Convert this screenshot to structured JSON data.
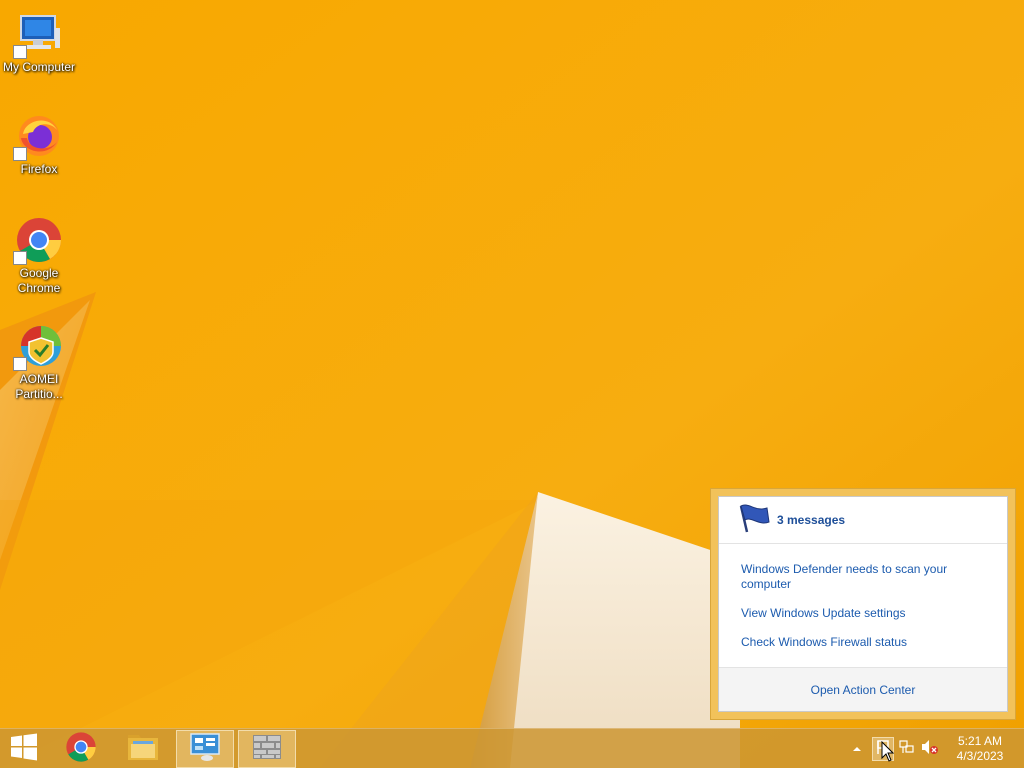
{
  "desktop": {
    "icons": [
      {
        "label": "My Computer",
        "icon": "computer-icon"
      },
      {
        "label": "Firefox",
        "icon": "firefox-icon"
      },
      {
        "label": "Google Chrome",
        "icon": "chrome-icon"
      },
      {
        "label": "AOMEI Partitio...",
        "icon": "aomei-partition-icon"
      }
    ]
  },
  "action_center": {
    "header": "3 messages",
    "messages": [
      "Windows Defender needs to scan your computer",
      "View Windows Update settings",
      "Check Windows Firewall status"
    ],
    "footer_link": "Open Action Center",
    "icon": "flag-icon"
  },
  "taskbar": {
    "start_icon": "windows-logo-icon",
    "pinned": [
      {
        "name": "chrome",
        "icon": "chrome-icon",
        "active": false
      },
      {
        "name": "file-explorer",
        "icon": "folder-icon",
        "active": false
      },
      {
        "name": "control-panel",
        "icon": "control-panel-icon",
        "active": true
      },
      {
        "name": "firewall",
        "icon": "firewall-icon",
        "active": true
      }
    ],
    "tray": {
      "icons": [
        "show-hidden-icons-icon",
        "action-center-flag-icon",
        "network-icon",
        "volume-muted-icon"
      ],
      "time": "5:21 AM",
      "date": "4/3/2023"
    }
  },
  "colors": {
    "wallpaper_base": "#f7a600",
    "link": "#1c5bae",
    "taskbar": "#cd9632"
  }
}
